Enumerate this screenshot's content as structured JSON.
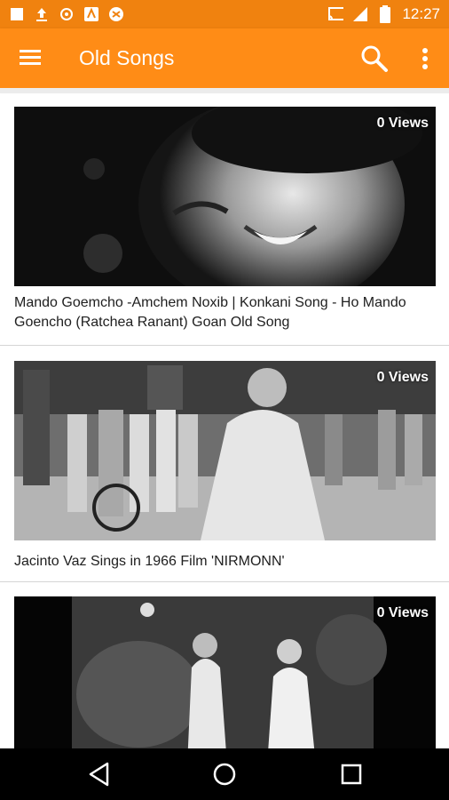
{
  "status_bar": {
    "time": "12:27",
    "icons": [
      "notification-square-icon",
      "upload-icon",
      "sync-icon",
      "app-icon",
      "app-icon",
      "cast-icon",
      "signal-icon",
      "battery-icon"
    ],
    "color": "#f0820f"
  },
  "app_bar": {
    "title": "Old Songs",
    "color": "#ff8c16",
    "menu_icon": "hamburger-menu-icon",
    "search_icon": "search-icon",
    "more_icon": "more-vertical-icon"
  },
  "videos": [
    {
      "title": "Mando Goemcho -Amchem Noxib | Konkani Song - Ho Mando Goencho (Ratchea Ranant) Goan Old Song",
      "views": "0 Views"
    },
    {
      "title": "Jacinto Vaz Sings in 1966 Film 'NIRMONN'",
      "views": "0 Views"
    },
    {
      "title": "",
      "views": "0 Views"
    }
  ],
  "nav_bar": {
    "back_icon": "back-triangle-icon",
    "home_icon": "home-circle-icon",
    "recents_icon": "recents-square-icon"
  }
}
